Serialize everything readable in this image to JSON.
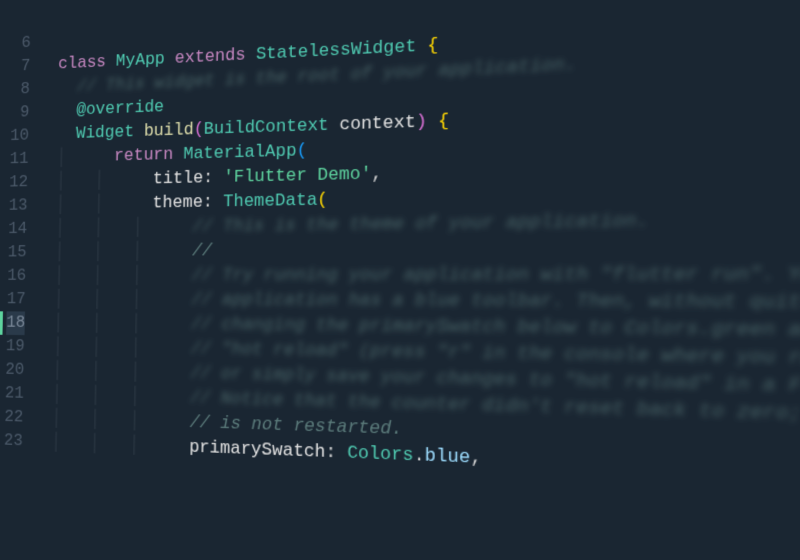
{
  "editor": {
    "highlighted_line": 18,
    "lines": [
      {
        "num": 6,
        "tokens": []
      },
      {
        "num": 7,
        "tokens": [
          {
            "t": "class ",
            "c": "kw"
          },
          {
            "t": "MyApp ",
            "c": "cls"
          },
          {
            "t": "extends ",
            "c": "kw"
          },
          {
            "t": "StatelessWidget ",
            "c": "cls"
          },
          {
            "t": "{",
            "c": "paren1"
          }
        ]
      },
      {
        "num": 8,
        "indent": 1,
        "tokens": [
          {
            "t": "// This widget is the root of your application.",
            "c": "cmt blur-right"
          }
        ]
      },
      {
        "num": 9,
        "indent": 1,
        "tokens": [
          {
            "t": "@override",
            "c": "ann"
          }
        ]
      },
      {
        "num": 10,
        "indent": 1,
        "tokens": [
          {
            "t": "Widget ",
            "c": "cls"
          },
          {
            "t": "build",
            "c": "fn"
          },
          {
            "t": "(",
            "c": "paren2"
          },
          {
            "t": "BuildContext ",
            "c": "cls"
          },
          {
            "t": "context",
            "c": "var"
          },
          {
            "t": ") ",
            "c": "paren2"
          },
          {
            "t": "{",
            "c": "paren1"
          }
        ]
      },
      {
        "num": 11,
        "indent": 2,
        "tokens": [
          {
            "t": "return ",
            "c": "kw"
          },
          {
            "t": "MaterialApp",
            "c": "cls"
          },
          {
            "t": "(",
            "c": "paren3"
          }
        ]
      },
      {
        "num": 12,
        "indent": 3,
        "tokens": [
          {
            "t": "title",
            "c": "prop"
          },
          {
            "t": ": ",
            "c": "punct"
          },
          {
            "t": "'Flutter Demo'",
            "c": "str"
          },
          {
            "t": ",",
            "c": "punct"
          }
        ]
      },
      {
        "num": 13,
        "indent": 3,
        "tokens": [
          {
            "t": "theme",
            "c": "prop"
          },
          {
            "t": ": ",
            "c": "punct"
          },
          {
            "t": "ThemeData",
            "c": "cls"
          },
          {
            "t": "(",
            "c": "paren1"
          }
        ]
      },
      {
        "num": 14,
        "indent": 4,
        "tokens": [
          {
            "t": "// This is the theme of your application.",
            "c": "cmt blur-right"
          }
        ]
      },
      {
        "num": 15,
        "indent": 4,
        "tokens": [
          {
            "t": "//",
            "c": "cmt"
          }
        ]
      },
      {
        "num": 16,
        "indent": 4,
        "tokens": [
          {
            "t": "// Try running your application with \"flutter run\". You'll see the",
            "c": "cmt blur-right"
          }
        ]
      },
      {
        "num": 17,
        "indent": 4,
        "tokens": [
          {
            "t": "// application has a blue toolbar. Then, without quitting the app, try",
            "c": "cmt blur-right"
          }
        ]
      },
      {
        "num": 18,
        "indent": 4,
        "tokens": [
          {
            "t": "// changing the primarySwatch below to Colors.green and then invoke",
            "c": "cmt blur-right"
          }
        ]
      },
      {
        "num": 19,
        "indent": 4,
        "tokens": [
          {
            "t": "// \"hot reload\" (press \"r\" in the console where you ran \"flutter run\",",
            "c": "cmt blur-right"
          }
        ]
      },
      {
        "num": 20,
        "indent": 4,
        "tokens": [
          {
            "t": "// or simply save your changes to \"hot reload\" in a Flutter IDE).",
            "c": "cmt blur-right"
          }
        ]
      },
      {
        "num": 21,
        "indent": 4,
        "tokens": [
          {
            "t": "// Notice that the counter didn't reset back to zero; the application",
            "c": "cmt blur-right"
          }
        ]
      },
      {
        "num": 22,
        "indent": 4,
        "tokens": [
          {
            "t": "// is not restarted.",
            "c": "cmt"
          }
        ]
      },
      {
        "num": 23,
        "indent": 4,
        "tokens": [
          {
            "t": "primarySwatch",
            "c": "prop"
          },
          {
            "t": ": ",
            "c": "punct"
          },
          {
            "t": "Colors",
            "c": "cls"
          },
          {
            "t": ".",
            "c": "punct"
          },
          {
            "t": "blue",
            "c": "enum"
          },
          {
            "t": ",",
            "c": "punct"
          }
        ]
      }
    ]
  }
}
